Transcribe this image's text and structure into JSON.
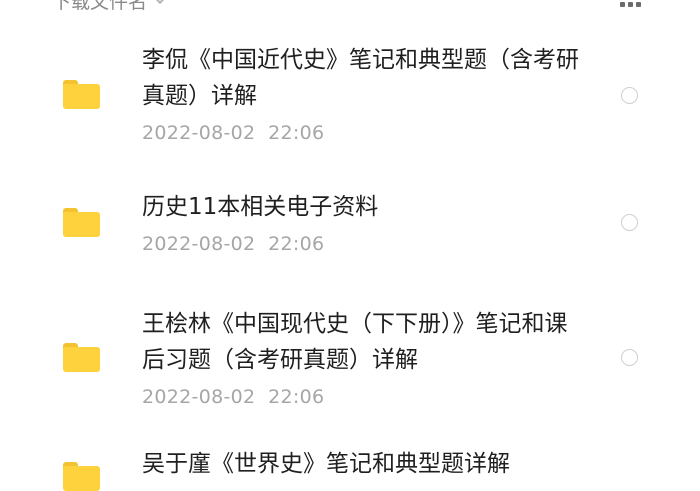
{
  "header": {
    "sort_label": "下载文件名"
  },
  "files": [
    {
      "name": "李侃《中国近代史》笔记和典型题（含考研真题）详解",
      "date": "2022-08-02  22:06"
    },
    {
      "name": "历史11本相关电子资料",
      "date": "2022-08-02  22:06"
    },
    {
      "name": "王桧林《中国现代史（下下册）》笔记和课后习题（含考研真题）详解",
      "date": "2022-08-02  22:06"
    },
    {
      "name": "吴于廑《世界史》笔记和典型题详解",
      "date": ""
    }
  ],
  "colors": {
    "folder": "#fdd23d",
    "folder_tab": "#f2c230",
    "date_text": "#a6a6a6"
  }
}
